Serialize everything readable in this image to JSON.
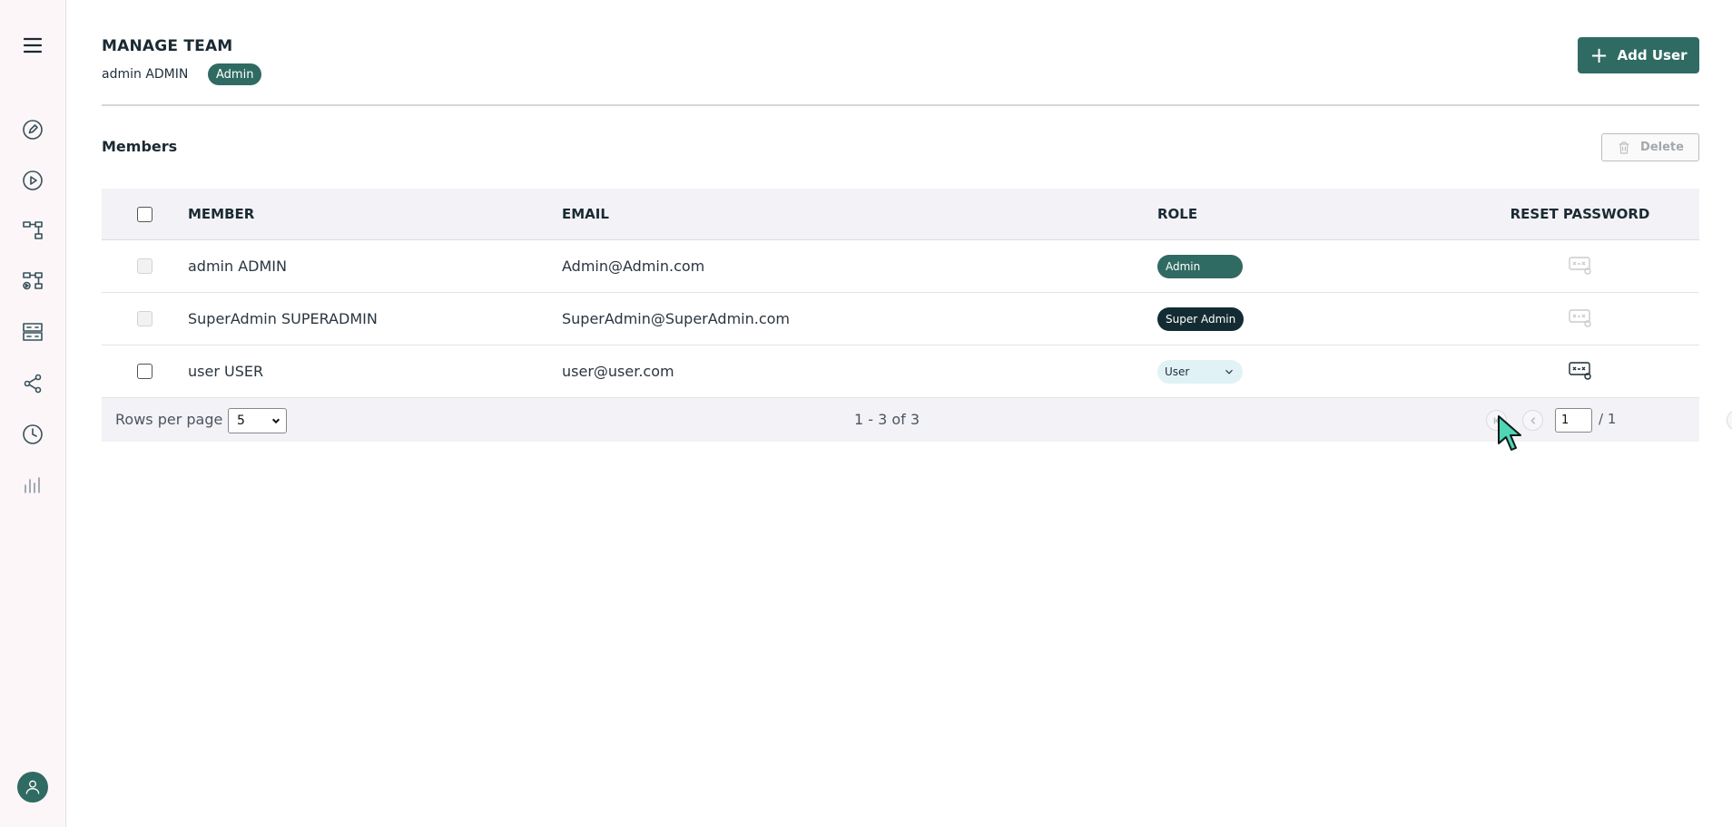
{
  "sidebar": {
    "items": [
      {
        "icon": "menu-icon"
      },
      {
        "icon": "edit-icon"
      },
      {
        "icon": "play-icon"
      },
      {
        "icon": "flow-icon"
      },
      {
        "icon": "media-flow-icon"
      },
      {
        "icon": "server-icon"
      },
      {
        "icon": "share-icon"
      },
      {
        "icon": "clock-icon"
      },
      {
        "icon": "analytics-icon"
      }
    ],
    "avatar": "user-avatar-icon"
  },
  "header": {
    "title": "MANAGE TEAM",
    "user_name": "admin ADMIN",
    "role_badge": "Admin",
    "add_user_label": "Add User"
  },
  "members": {
    "title": "Members",
    "delete_label": "Delete",
    "columns": [
      "MEMBER",
      "EMAIL",
      "ROLE",
      "RESET PASSWORD"
    ],
    "rows": [
      {
        "member": "admin ADMIN",
        "email": "Admin@Admin.com",
        "role": "Admin",
        "checkbox_disabled": true,
        "reset_disabled": true
      },
      {
        "member": "SuperAdmin SUPERADMIN",
        "email": "SuperAdmin@SuperAdmin.com",
        "role": "Super Admin",
        "checkbox_disabled": true,
        "reset_disabled": true
      },
      {
        "member": "user USER",
        "email": "user@user.com",
        "role": "User",
        "checkbox_disabled": false,
        "reset_disabled": false
      }
    ]
  },
  "pagination": {
    "rows_per_page_label": "Rows per page",
    "rows_per_page_value": "5",
    "range_text": "1 - 3 of 3",
    "current_page": "1",
    "total_pages": "/ 1"
  },
  "colors": {
    "primary": "#2f6b62",
    "dark_chip": "#132c33",
    "user_chip": "#e1f2f6",
    "sidebar_bg": "#fdf6f8",
    "table_header_bg": "#f3f2f6"
  }
}
